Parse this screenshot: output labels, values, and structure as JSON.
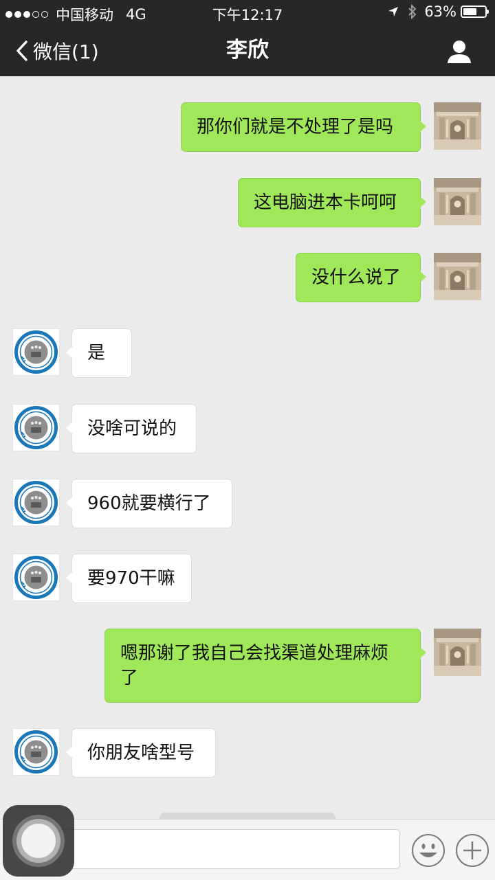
{
  "status_bar": {
    "carrier": "中国移动",
    "network": "4G",
    "time": "下午12:17",
    "battery_percent": "63%",
    "battery_level": 0.63,
    "signal_bars_filled": 3,
    "signal_bars_total": 5
  },
  "nav": {
    "back_label": "微信(1)",
    "title": "李欣"
  },
  "messages": [
    {
      "side": "sent",
      "text": "那你们就是不处理了是吗"
    },
    {
      "side": "sent",
      "text": "这电脑进本卡呵呵"
    },
    {
      "side": "sent",
      "text": "没什么说了"
    },
    {
      "side": "received",
      "text": "是"
    },
    {
      "side": "received",
      "text": "没啥可说的"
    },
    {
      "side": "received",
      "text": "960就要横行了"
    },
    {
      "side": "received",
      "text": "要970干嘛"
    },
    {
      "side": "sent",
      "text": "嗯那谢了我自己会找渠道处理麻烦了"
    },
    {
      "side": "received",
      "text": "你朋友啥型号"
    }
  ],
  "input": {
    "value": "",
    "placeholder": ""
  },
  "colors": {
    "header_bg": "#27272a",
    "chat_bg": "#ebebeb",
    "sent_bubble": "#a0e75a",
    "received_bubble": "#ffffff",
    "received_avatar_ring": "#1a78b8"
  },
  "icons": {
    "back": "chevron-left-icon",
    "contact": "person-icon",
    "location": "location-arrow-icon",
    "bluetooth": "bluetooth-icon",
    "emoji": "smiley-face-icon",
    "more": "plus-circle-icon",
    "sent_avatar": "fountain-photo-avatar",
    "received_avatar": "university-seal-avatar"
  }
}
